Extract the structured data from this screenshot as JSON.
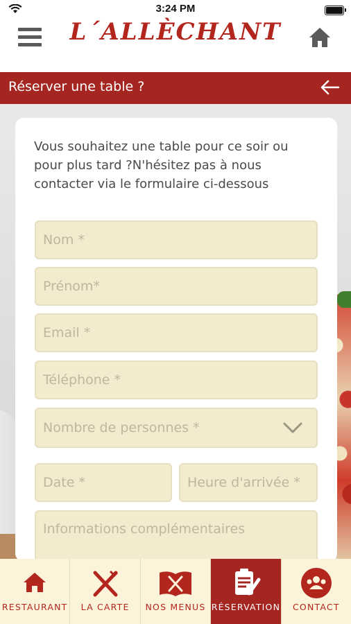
{
  "status": {
    "time": "3:24 PM"
  },
  "header": {
    "brand": "L´ALLÈCHANT",
    "menu_icon": "hamburger-icon",
    "home_icon": "home-icon"
  },
  "titlebar": {
    "title": "Réserver une table ?",
    "back_icon": "arrow-left-icon"
  },
  "form": {
    "intro": "Vous souhaitez une table pour ce soir ou pour plus tard ?N'hésitez pas à nous contacter via le formulaire ci-dessous",
    "nom": "Nom *",
    "prenom": "Prénom*",
    "email": "Email *",
    "telephone": "Téléphone *",
    "personnes": "Nombre de personnes *",
    "date": "Date *",
    "heure": "Heure d'arrivée *",
    "info": "Informations complémentaires"
  },
  "tabs": [
    {
      "label": "RESTAURANT",
      "icon": "restaurant-icon"
    },
    {
      "label": "LA CARTE",
      "icon": "fork-knife-icon"
    },
    {
      "label": "NOS MENUS",
      "icon": "menu-book-icon"
    },
    {
      "label": "RÉSERVATION",
      "icon": "clipboard-icon",
      "active": true
    },
    {
      "label": "CONTACT",
      "icon": "contact-icon"
    }
  ],
  "colors": {
    "brand": "#b3261e",
    "bar": "#a52521",
    "field_bg": "#f2ebcd",
    "tabbar_bg": "#fbf3da"
  }
}
